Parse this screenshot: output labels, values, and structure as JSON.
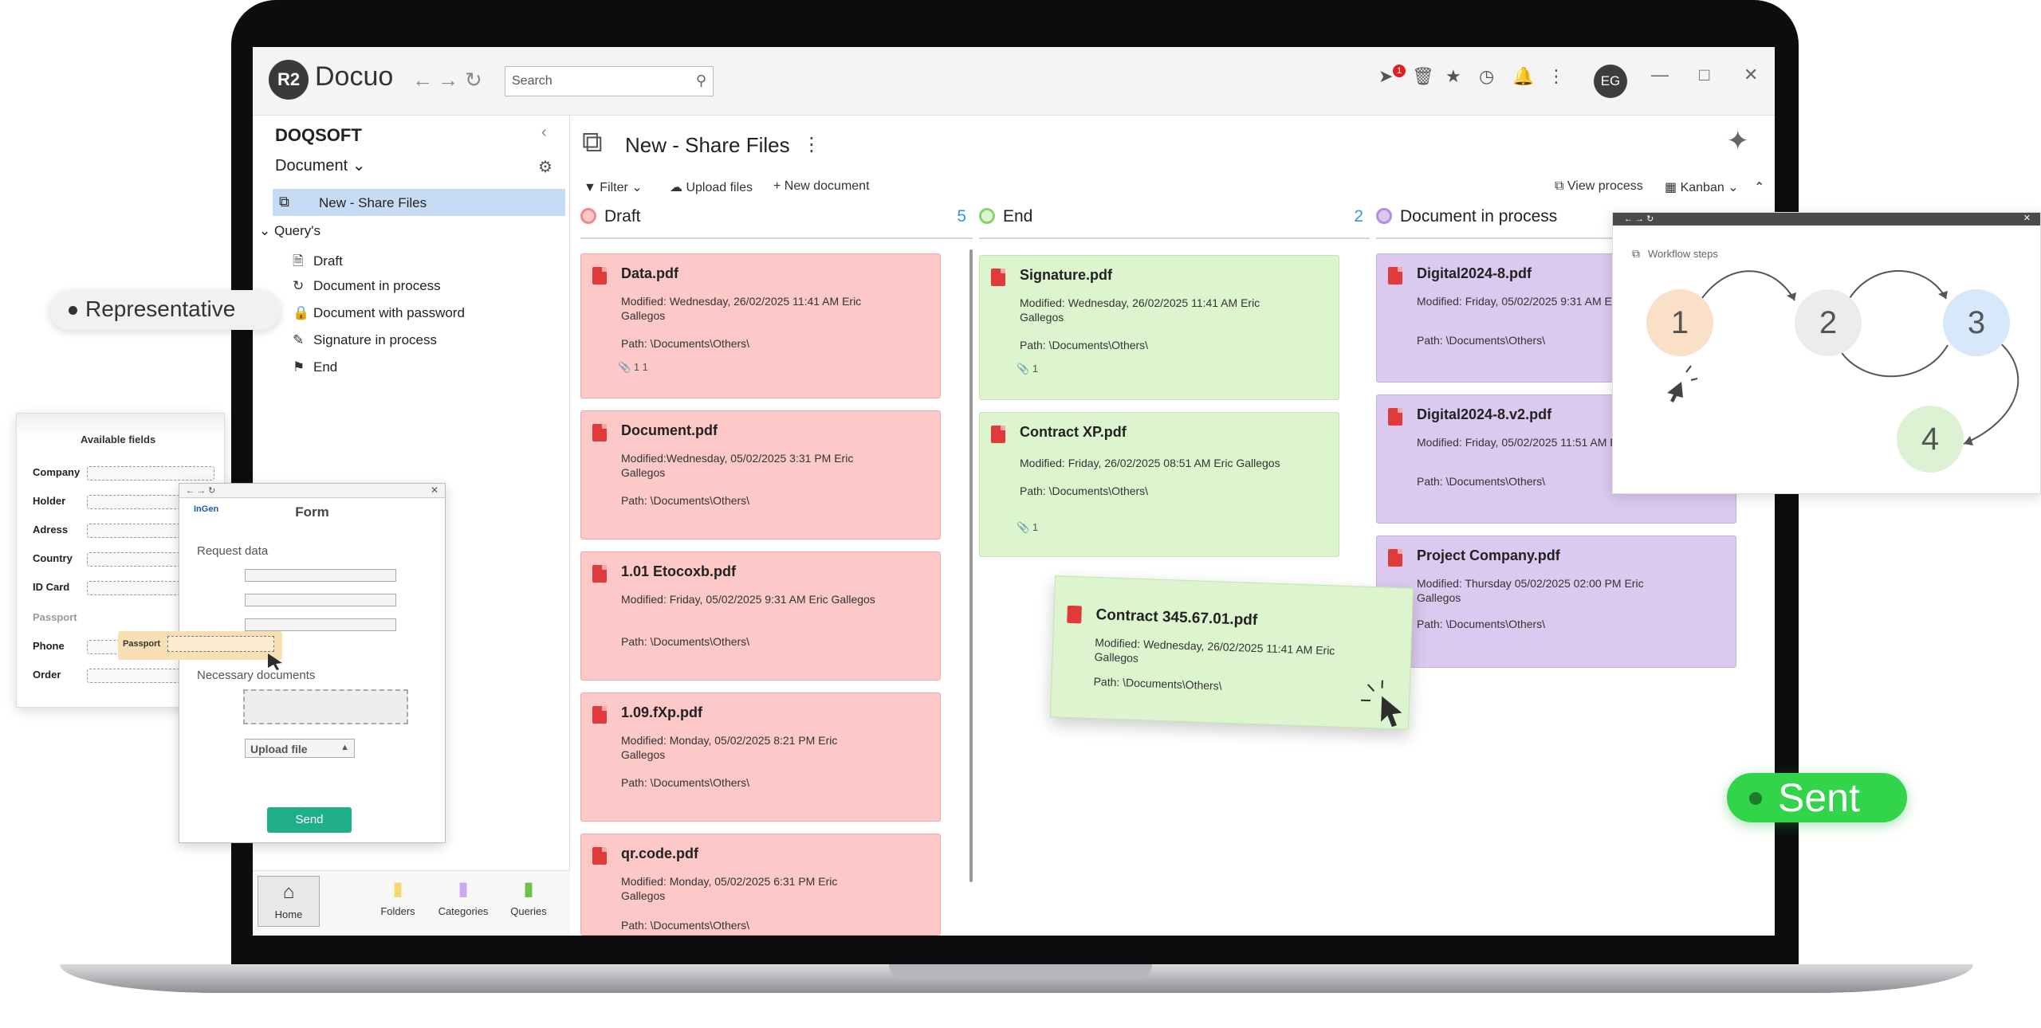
{
  "app": {
    "logo_mark": "R2",
    "name": "Docuo",
    "search_placeholder": "Search",
    "notification_count": "1",
    "avatar_initials": "EG",
    "icons": [
      "back-arrow-icon",
      "forward-arrow-icon",
      "refresh-icon",
      "search-icon",
      "notification-icon",
      "trash-icon",
      "star-icon",
      "history-icon",
      "bell-icon",
      "menu-dots-icon",
      "minimize-icon",
      "maximize-icon",
      "close-icon"
    ]
  },
  "sidebar": {
    "org": "DOQSOFT",
    "section": "Document",
    "active_item": "New - Share Files",
    "group": "Query's",
    "items": [
      {
        "label": "Draft",
        "icon": "file-icon"
      },
      {
        "label": "Document in process",
        "icon": "spinner-icon"
      },
      {
        "label": "Document with password",
        "icon": "lock-icon"
      },
      {
        "label": "Signature in process",
        "icon": "signature-icon"
      },
      {
        "label": "End",
        "icon": "finish-flag-icon"
      }
    ],
    "bottom_tabs": [
      {
        "label": "Home",
        "icon": "home-icon",
        "color": "#333333"
      },
      {
        "label": "Folders",
        "icon": "folder-icon",
        "color": "#f5d76e"
      },
      {
        "label": "Categories",
        "icon": "categories-icon",
        "color": "#c9a9ef"
      },
      {
        "label": "Queries",
        "icon": "queries-icon",
        "color": "#6cc24a"
      }
    ]
  },
  "main": {
    "title": "New - Share Files",
    "toolbar": {
      "filter": "Filter",
      "upload": "Upload files",
      "new_doc": "New document",
      "view_process": "View process",
      "view_mode": "Kanban"
    },
    "columns": [
      {
        "title": "Draft",
        "count": "5",
        "color": "#f08b8b",
        "fill": "#fcc8c8",
        "cards": [
          {
            "name": "Data.pdf",
            "meta": "Modified: Wednesday, 26/02/2025 11:41 AM Eric Gallegos",
            "path": "Path: \\Documents\\Others\\",
            "foot": "1   1"
          },
          {
            "name": "Document.pdf",
            "meta": "Modified:Wednesday, 05/02/2025 3:31 PM Eric Gallegos",
            "path": "Path: \\Documents\\Others\\",
            "foot": ""
          },
          {
            "name": "1.01 Etocoxb.pdf",
            "meta": "Modified: Friday, 05/02/2025 9:31 AM Eric Gallegos",
            "path": "Path: \\Documents\\Others\\",
            "foot": ""
          },
          {
            "name": "1.09.fXp.pdf",
            "meta": "Modified: Monday, 05/02/2025 8:21 PM Eric Gallegos",
            "path": "Path: \\Documents\\Others\\",
            "foot": ""
          },
          {
            "name": "qr.code.pdf",
            "meta": "Modified: Monday, 05/02/2025 6:31 PM Eric Gallegos",
            "path": "Path: \\Documents\\Others\\",
            "foot": ""
          }
        ]
      },
      {
        "title": "End",
        "count": "2",
        "color": "#8ccf6f",
        "fill": "#ddf5cf",
        "cards": [
          {
            "name": "Signature.pdf",
            "meta": "Modified: Wednesday, 26/02/2025 11:41 AM Eric Gallegos",
            "path": "Path: \\Documents\\Others\\",
            "foot": "1"
          },
          {
            "name": "Contract XP.pdf",
            "meta": "Modified: Friday, 26/02/2025 08:51 AM Eric Gallegos",
            "path": "Path: \\Documents\\Others\\",
            "foot": "1"
          }
        ]
      },
      {
        "title": "Document in process",
        "count": "",
        "color": "#b58ee0",
        "fill": "#dcc9ef",
        "cards": [
          {
            "name": "Digital2024-8.pdf",
            "meta": "Modified: Friday, 05/02/2025 9:31 AM Eric Gallegos",
            "path": "Path: \\Documents\\Others\\",
            "foot": ""
          },
          {
            "name": "Digital2024-8.v2.pdf",
            "meta": "Modified: Friday, 05/02/2025 11:51 AM Eric Gallegos",
            "path": "Path: \\Documents\\Others\\",
            "foot": ""
          },
          {
            "name": "Project Company.pdf",
            "meta": "Modified: Thursday 05/02/2025 02:00 PM Eric Gallegos",
            "path": "Path: \\Documents\\Others\\",
            "foot": ""
          }
        ]
      }
    ],
    "dragged_card": {
      "name": "Contract 345.67.01.pdf",
      "meta": "Modified: Wednesday, 26/02/2025 11:41 AM Eric Gallegos",
      "path": "Path: \\Documents\\Others\\"
    }
  },
  "overlays": {
    "representative": "Representative",
    "available_fields": {
      "title": "Available fields",
      "fields": [
        "Company",
        "Holder",
        "Adress",
        "Country",
        "ID Card",
        "Passport",
        "Phone",
        "Order"
      ]
    },
    "form": {
      "logo": "InGen",
      "title": "Form",
      "request_data": "Request data",
      "necessary_documents": "Necessary documents",
      "upload": "Upload file",
      "send": "Send"
    },
    "passport_tip": "Passport",
    "workflow": {
      "label": "Workflow steps",
      "steps": [
        {
          "n": "1",
          "color": "#fbe0c8"
        },
        {
          "n": "2",
          "color": "#ececec"
        },
        {
          "n": "3",
          "color": "#d6e8fa"
        },
        {
          "n": "4",
          "color": "#ddf2d2"
        }
      ]
    },
    "sent": "Sent"
  }
}
